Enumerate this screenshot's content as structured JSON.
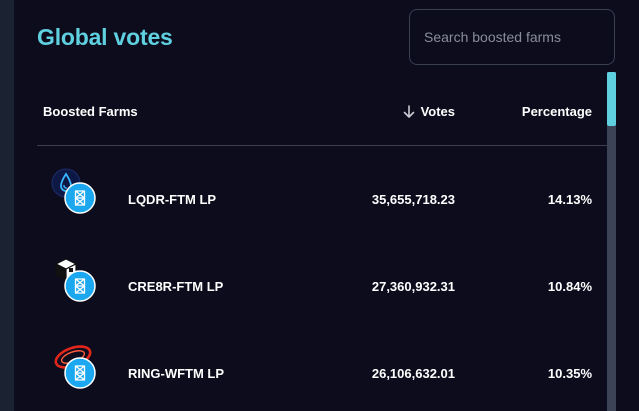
{
  "header": {
    "title": "Global votes",
    "search_placeholder": "Search boosted farms",
    "search_value": ""
  },
  "table": {
    "columns": {
      "farms": "Boosted Farms",
      "votes": "Votes",
      "percentage": "Percentage"
    },
    "sort": {
      "column": "votes",
      "direction": "descending",
      "icon": "arrow-down-icon"
    },
    "rows": [
      {
        "name": "LQDR-FTM LP",
        "votes": "35,655,718.23",
        "percentage": "14.13%",
        "token_icon": "liquiddriver-drop-icon",
        "base_icon": "fantom-icon"
      },
      {
        "name": "CRE8R-FTM LP",
        "votes": "27,360,932.31",
        "percentage": "10.84%",
        "token_icon": "cre8r-cube-icon",
        "base_icon": "fantom-icon"
      },
      {
        "name": "RING-WFTM LP",
        "votes": "26,106,632.01",
        "percentage": "10.35%",
        "token_icon": "ring-swirl-icon",
        "base_icon": "fantom-icon"
      }
    ]
  },
  "colors": {
    "background": "#0c0c1d",
    "accent": "#5fd0df",
    "fantom_blue": "#1ba8f0",
    "divider": "#3a3e50",
    "scroll_track": "#3c4356"
  },
  "scrollbar": {
    "position": 0
  }
}
